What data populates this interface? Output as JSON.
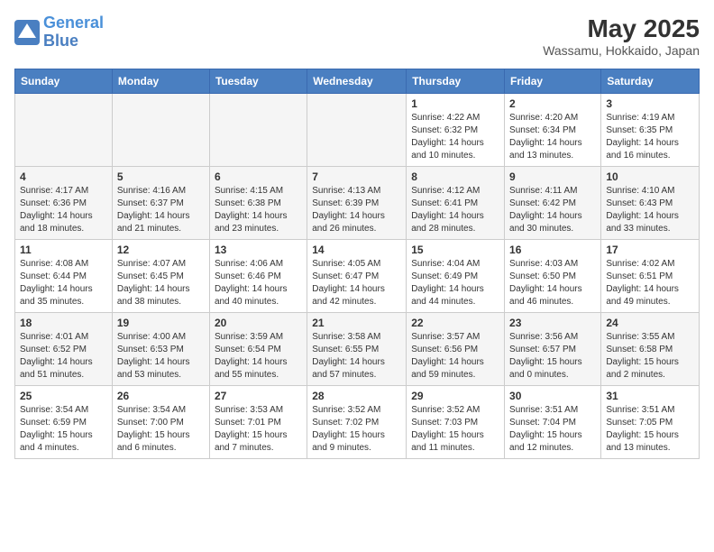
{
  "header": {
    "logo_line1": "General",
    "logo_line2": "Blue",
    "month": "May 2025",
    "location": "Wassamu, Hokkaido, Japan"
  },
  "weekdays": [
    "Sunday",
    "Monday",
    "Tuesday",
    "Wednesday",
    "Thursday",
    "Friday",
    "Saturday"
  ],
  "weeks": [
    [
      {
        "day": "",
        "info": ""
      },
      {
        "day": "",
        "info": ""
      },
      {
        "day": "",
        "info": ""
      },
      {
        "day": "",
        "info": ""
      },
      {
        "day": "1",
        "info": "Sunrise: 4:22 AM\nSunset: 6:32 PM\nDaylight: 14 hours\nand 10 minutes."
      },
      {
        "day": "2",
        "info": "Sunrise: 4:20 AM\nSunset: 6:34 PM\nDaylight: 14 hours\nand 13 minutes."
      },
      {
        "day": "3",
        "info": "Sunrise: 4:19 AM\nSunset: 6:35 PM\nDaylight: 14 hours\nand 16 minutes."
      }
    ],
    [
      {
        "day": "4",
        "info": "Sunrise: 4:17 AM\nSunset: 6:36 PM\nDaylight: 14 hours\nand 18 minutes."
      },
      {
        "day": "5",
        "info": "Sunrise: 4:16 AM\nSunset: 6:37 PM\nDaylight: 14 hours\nand 21 minutes."
      },
      {
        "day": "6",
        "info": "Sunrise: 4:15 AM\nSunset: 6:38 PM\nDaylight: 14 hours\nand 23 minutes."
      },
      {
        "day": "7",
        "info": "Sunrise: 4:13 AM\nSunset: 6:39 PM\nDaylight: 14 hours\nand 26 minutes."
      },
      {
        "day": "8",
        "info": "Sunrise: 4:12 AM\nSunset: 6:41 PM\nDaylight: 14 hours\nand 28 minutes."
      },
      {
        "day": "9",
        "info": "Sunrise: 4:11 AM\nSunset: 6:42 PM\nDaylight: 14 hours\nand 30 minutes."
      },
      {
        "day": "10",
        "info": "Sunrise: 4:10 AM\nSunset: 6:43 PM\nDaylight: 14 hours\nand 33 minutes."
      }
    ],
    [
      {
        "day": "11",
        "info": "Sunrise: 4:08 AM\nSunset: 6:44 PM\nDaylight: 14 hours\nand 35 minutes."
      },
      {
        "day": "12",
        "info": "Sunrise: 4:07 AM\nSunset: 6:45 PM\nDaylight: 14 hours\nand 38 minutes."
      },
      {
        "day": "13",
        "info": "Sunrise: 4:06 AM\nSunset: 6:46 PM\nDaylight: 14 hours\nand 40 minutes."
      },
      {
        "day": "14",
        "info": "Sunrise: 4:05 AM\nSunset: 6:47 PM\nDaylight: 14 hours\nand 42 minutes."
      },
      {
        "day": "15",
        "info": "Sunrise: 4:04 AM\nSunset: 6:49 PM\nDaylight: 14 hours\nand 44 minutes."
      },
      {
        "day": "16",
        "info": "Sunrise: 4:03 AM\nSunset: 6:50 PM\nDaylight: 14 hours\nand 46 minutes."
      },
      {
        "day": "17",
        "info": "Sunrise: 4:02 AM\nSunset: 6:51 PM\nDaylight: 14 hours\nand 49 minutes."
      }
    ],
    [
      {
        "day": "18",
        "info": "Sunrise: 4:01 AM\nSunset: 6:52 PM\nDaylight: 14 hours\nand 51 minutes."
      },
      {
        "day": "19",
        "info": "Sunrise: 4:00 AM\nSunset: 6:53 PM\nDaylight: 14 hours\nand 53 minutes."
      },
      {
        "day": "20",
        "info": "Sunrise: 3:59 AM\nSunset: 6:54 PM\nDaylight: 14 hours\nand 55 minutes."
      },
      {
        "day": "21",
        "info": "Sunrise: 3:58 AM\nSunset: 6:55 PM\nDaylight: 14 hours\nand 57 minutes."
      },
      {
        "day": "22",
        "info": "Sunrise: 3:57 AM\nSunset: 6:56 PM\nDaylight: 14 hours\nand 59 minutes."
      },
      {
        "day": "23",
        "info": "Sunrise: 3:56 AM\nSunset: 6:57 PM\nDaylight: 15 hours\nand 0 minutes."
      },
      {
        "day": "24",
        "info": "Sunrise: 3:55 AM\nSunset: 6:58 PM\nDaylight: 15 hours\nand 2 minutes."
      }
    ],
    [
      {
        "day": "25",
        "info": "Sunrise: 3:54 AM\nSunset: 6:59 PM\nDaylight: 15 hours\nand 4 minutes."
      },
      {
        "day": "26",
        "info": "Sunrise: 3:54 AM\nSunset: 7:00 PM\nDaylight: 15 hours\nand 6 minutes."
      },
      {
        "day": "27",
        "info": "Sunrise: 3:53 AM\nSunset: 7:01 PM\nDaylight: 15 hours\nand 7 minutes."
      },
      {
        "day": "28",
        "info": "Sunrise: 3:52 AM\nSunset: 7:02 PM\nDaylight: 15 hours\nand 9 minutes."
      },
      {
        "day": "29",
        "info": "Sunrise: 3:52 AM\nSunset: 7:03 PM\nDaylight: 15 hours\nand 11 minutes."
      },
      {
        "day": "30",
        "info": "Sunrise: 3:51 AM\nSunset: 7:04 PM\nDaylight: 15 hours\nand 12 minutes."
      },
      {
        "day": "31",
        "info": "Sunrise: 3:51 AM\nSunset: 7:05 PM\nDaylight: 15 hours\nand 13 minutes."
      }
    ]
  ]
}
